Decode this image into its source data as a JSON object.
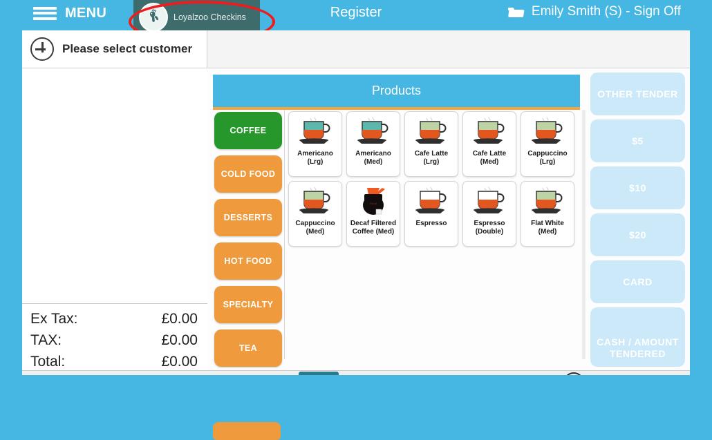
{
  "topbar": {
    "menu_label": "MENU",
    "menu_icon": "hamburger-icon",
    "title": "Register",
    "folder_icon": "folder-icon",
    "user": "Emily Smith (S) - Sign Off",
    "loyalzoo": {
      "label": "Loyalzoo Checkins",
      "logo_icon": "giraffe-logo-icon",
      "badge_color": "#3e6b6b"
    },
    "annotation": {
      "shape": "ellipse",
      "color": "#ee1c1c"
    },
    "bar_color": "#46b6e3"
  },
  "customer_bar": {
    "add_icon": "plus-circle-icon",
    "text": "Please select customer"
  },
  "totals": [
    {
      "label": "Ex Tax:",
      "value": "£0.00"
    },
    {
      "label": "TAX:",
      "value": "£0.00"
    },
    {
      "label": "Total:",
      "value": "£0.00"
    }
  ],
  "products": {
    "header": "Products",
    "header_color": "#46b6e3",
    "header_underline": "#f5a43c",
    "categories": [
      {
        "label": "COFFEE",
        "active": true,
        "color": "#26972a"
      },
      {
        "label": "COLD FOOD",
        "active": false,
        "color": "#ef9a3c"
      },
      {
        "label": "DESSERTS",
        "active": false,
        "color": "#ef9a3c"
      },
      {
        "label": "HOT FOOD",
        "active": false,
        "color": "#ef9a3c"
      },
      {
        "label": "SPECIALTY",
        "active": false,
        "color": "#ef9a3c"
      },
      {
        "label": "TEA",
        "active": false,
        "color": "#ef9a3c"
      }
    ],
    "items": [
      {
        "name": "Americano\n(Lrg)",
        "icon": "coffee-cup-icon",
        "top": "#5cb8ac",
        "bottom": "#e2561f",
        "caption": "Americano"
      },
      {
        "name": "Americano\n(Med)",
        "icon": "coffee-cup-icon",
        "top": "#5cb8ac",
        "bottom": "#e2561f",
        "caption": "Americano"
      },
      {
        "name": "Cafe Latte\n(Lrg)",
        "icon": "coffee-cup-icon",
        "top": "#bdd3a4",
        "bottom": "#e2561f",
        "caption": "Cafe Latte"
      },
      {
        "name": "Cafe Latte\n(Med)",
        "icon": "coffee-cup-icon",
        "top": "#bdd3a4",
        "bottom": "#e2561f",
        "caption": "Cafe Latte"
      },
      {
        "name": "Cappuccino\n(Lrg)",
        "icon": "coffee-cup-icon",
        "top": "#bdd3a4",
        "bottom": "#e2561f",
        "caption": "Cappuccino"
      },
      {
        "name": "Cappuccino\n(Med)",
        "icon": "coffee-cup-icon",
        "top": "#bdd3a4",
        "bottom": "#e2561f",
        "caption": "Cappuccino"
      },
      {
        "name": "Decaf Filtered\nCoffee (Med)",
        "icon": "coffee-carafe-icon",
        "top": "#1a1a1a",
        "bottom": "#1a1a1a",
        "caption": "Decaf"
      },
      {
        "name": "Espresso",
        "icon": "coffee-cup-icon",
        "top": "#ffffff",
        "bottom": "#e2561f",
        "caption": "Espresso"
      },
      {
        "name": "Espresso\n(Double)",
        "icon": "coffee-cup-icon",
        "top": "#ffffff",
        "bottom": "#e2561f",
        "caption": "Dbl Espresso"
      },
      {
        "name": "Flat White\n(Med)",
        "icon": "coffee-cup-icon",
        "top": "#bdd3a4",
        "bottom": "#e2561f",
        "caption": "Flat White"
      }
    ]
  },
  "tender": {
    "color": "#cbe9f8",
    "buttons": [
      {
        "label": "OTHER TENDER",
        "tall": false
      },
      {
        "label": "$5",
        "tall": false
      },
      {
        "label": "$10",
        "tall": false
      },
      {
        "label": "$20",
        "tall": false
      },
      {
        "label": "CARD",
        "tall": false
      },
      {
        "label": "CASH / AMOUNT\nTENDERED",
        "tall": true
      }
    ]
  }
}
